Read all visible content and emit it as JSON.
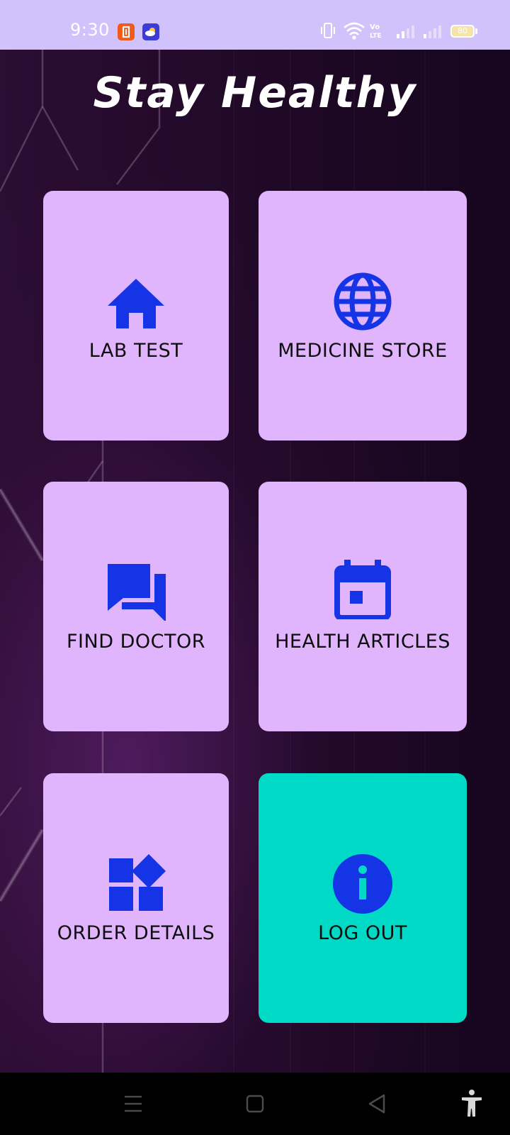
{
  "status_bar": {
    "time": "9:30",
    "battery_level": "80",
    "notification_icons": [
      "app-notification-icon",
      "weather-icon"
    ],
    "status_icons": [
      "vibrate-icon",
      "wifi-icon",
      "volte-icon",
      "signal-icon",
      "signal-icon",
      "battery-icon"
    ]
  },
  "header": {
    "title": "Stay Healthy"
  },
  "menu": {
    "items": [
      {
        "label": "LAB TEST",
        "icon": "home-icon"
      },
      {
        "label": "MEDICINE STORE",
        "icon": "globe-icon"
      },
      {
        "label": "FIND DOCTOR",
        "icon": "chat-icon"
      },
      {
        "label": "HEALTH ARTICLES",
        "icon": "calendar-icon"
      },
      {
        "label": "ORDER DETAILS",
        "icon": "widgets-icon"
      },
      {
        "label": "LOG OUT",
        "icon": "info-icon"
      }
    ]
  },
  "nav_bar": {
    "buttons": [
      "menu-icon",
      "home-square-icon",
      "back-icon",
      "accessibility-icon"
    ]
  },
  "colors": {
    "status_bar_bg": "#d2c2fb",
    "card_bg": "#e1b5fd",
    "logout_card_bg": "#00d9c5",
    "icon_blue": "#1434e6",
    "label_text": "#0d0d0d",
    "title_text": "#ffffff"
  }
}
